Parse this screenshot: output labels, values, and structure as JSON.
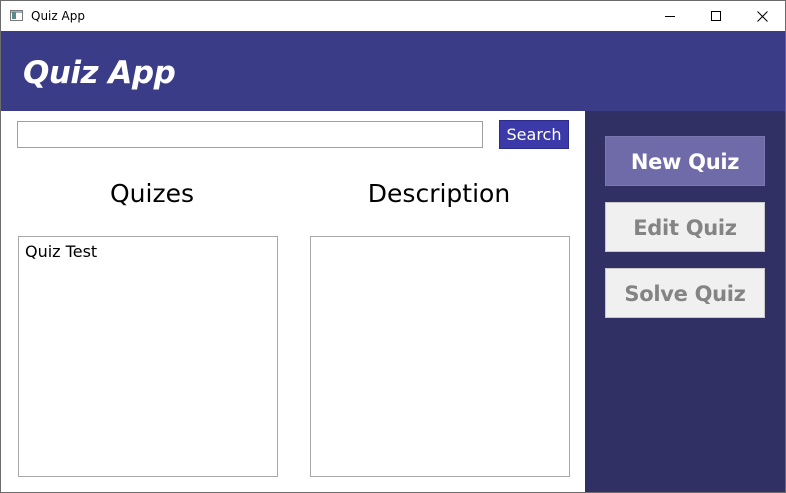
{
  "window": {
    "title": "Quiz App",
    "controls": {
      "minimize_icon": "minimize-icon",
      "maximize_icon": "maximize-icon",
      "close_icon": "close-icon"
    }
  },
  "header": {
    "title": "Quiz App",
    "background_color": "#3b3c88"
  },
  "search": {
    "value": "",
    "placeholder": "",
    "button_label": "Search",
    "button_color": "#3b3aa8"
  },
  "quizzes": {
    "heading": "Quizes",
    "items": [
      "Quiz Test"
    ]
  },
  "description": {
    "heading": "Description",
    "text": ""
  },
  "sidebar": {
    "background_color": "#313065",
    "new_quiz_label": "New Quiz",
    "edit_quiz_label": "Edit Quiz",
    "solve_quiz_label": "Solve Quiz",
    "new_quiz_color": "#6f6aa8"
  }
}
